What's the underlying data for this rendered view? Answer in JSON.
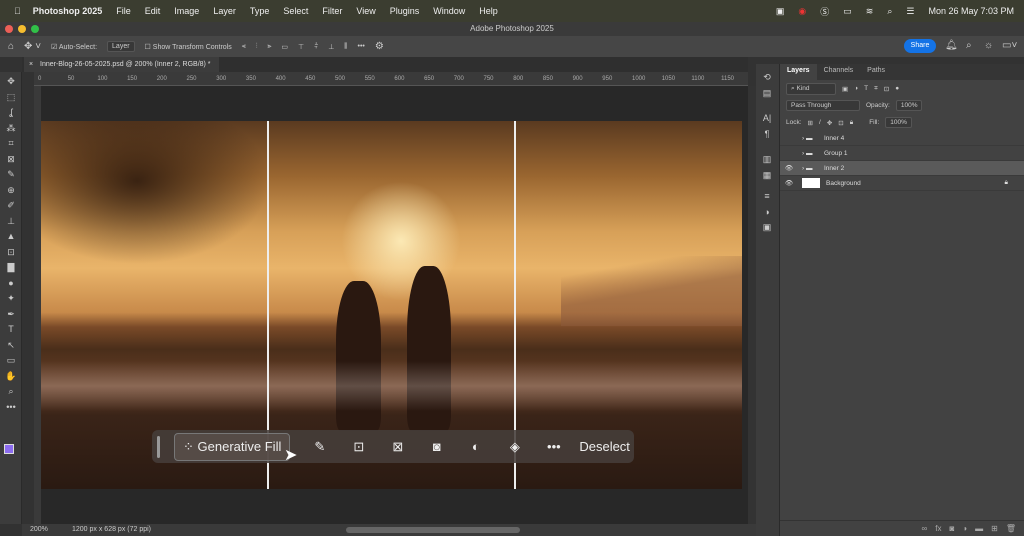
{
  "menubar": {
    "app": "Photoshop 2025",
    "items": [
      "File",
      "Edit",
      "Image",
      "Layer",
      "Type",
      "Select",
      "Filter",
      "View",
      "Plugins",
      "Window",
      "Help"
    ],
    "clock": "Mon 26 May  7:03 PM"
  },
  "window": {
    "title": "Adobe Photoshop 2025"
  },
  "options": {
    "auto_select": "Auto-Select:",
    "layer": "Layer",
    "show_transform": "Show Transform Controls",
    "more": "•••",
    "share": "Share"
  },
  "document": {
    "tab": "Inner-Blog-26-05-2025.psd @ 200% (Inner 2, RGB/8) *",
    "close": "×"
  },
  "ruler": [
    "0",
    "50",
    "100",
    "150",
    "200",
    "250",
    "300",
    "350",
    "400",
    "450",
    "500",
    "550",
    "600",
    "650",
    "700",
    "750",
    "800",
    "850",
    "900",
    "950",
    "1000",
    "1050",
    "1100",
    "1150"
  ],
  "tools": [
    "✥",
    "⬚",
    "ʆ",
    "⁂",
    "⌗",
    "⊠",
    "✎",
    "⊕",
    "✐",
    "⊥",
    "▲",
    "⊡",
    "▇",
    "●",
    "✦",
    "✒",
    "T",
    "↖",
    "▭",
    "✋",
    "⌕",
    "•••"
  ],
  "contextbar": {
    "generative_fill": "Generative Fill",
    "deselect": "Deselect"
  },
  "status": {
    "zoom": "200%",
    "info": "1200 px x 628 px (72 ppi)"
  },
  "panel": {
    "tabs": [
      "Layers",
      "Channels",
      "Paths"
    ],
    "kind": "Kind",
    "blend": "Pass Through",
    "opacity_label": "Opacity:",
    "opacity": "100%",
    "lock_label": "Lock:",
    "fill_label": "Fill:",
    "fill": "100%",
    "layers": [
      {
        "name": "Inner 4",
        "visible": false,
        "group": true
      },
      {
        "name": "Group 1",
        "visible": false,
        "group": true
      },
      {
        "name": "Inner 2",
        "visible": true,
        "group": true,
        "selected": true
      },
      {
        "name": "Background",
        "visible": true,
        "group": false
      }
    ]
  }
}
